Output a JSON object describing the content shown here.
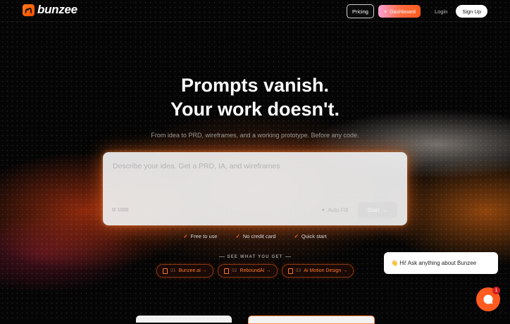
{
  "brand": {
    "name": "bunzee",
    "accent": "#ff5a1f"
  },
  "nav": {
    "pricing": "Pricing",
    "dashboard": "Dashboard",
    "login": "Login",
    "signup": "Sign Up"
  },
  "hero": {
    "line1": "Prompts vanish.",
    "line2": "Your work doesn't.",
    "subtitle": "From idea to PRD, wireframes, and a working prototype. Before any code."
  },
  "prompt": {
    "placeholder": "Describe your idea. Get a PRD, IA, and wireframes",
    "counter": "0/ 1000",
    "autofill": "Auto Fill",
    "start": "Start"
  },
  "features": [
    "Free to use",
    "No credit card",
    "Quick start"
  ],
  "see_label": "SEE WHAT YOU GET",
  "examples": [
    {
      "num": "01",
      "label": "Bunzee.ai →"
    },
    {
      "num": "02",
      "label": "ReboundAI →"
    },
    {
      "num": "03",
      "label": "Ai Motion Design →"
    }
  ],
  "chat": {
    "emoji": "👋",
    "text": "Hi! Ask anything about Bunzee",
    "badge": "1"
  }
}
